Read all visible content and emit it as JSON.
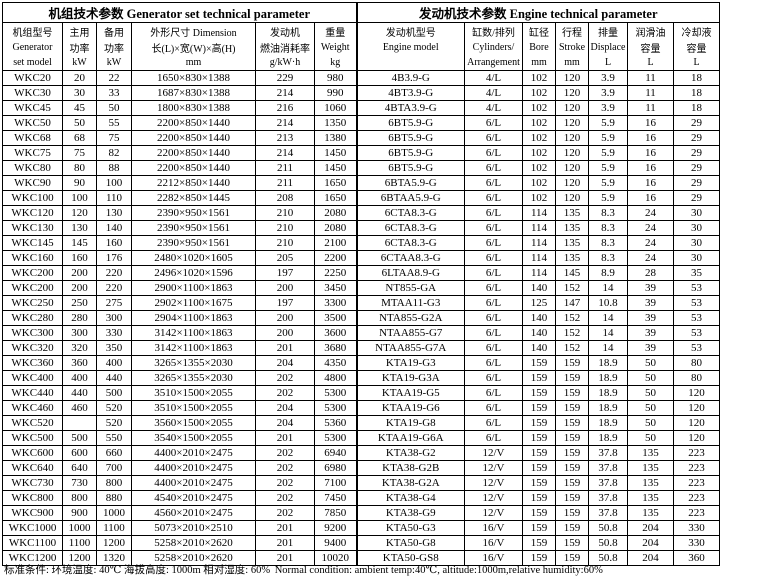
{
  "titles": {
    "generator": "机组技术参数 Generator set technical parameter",
    "engine": "发动机技术参数 Engine technical parameter"
  },
  "headers": {
    "model": [
      "机组型号",
      "Generator",
      "set model"
    ],
    "main_power": [
      "主用",
      "功率",
      "kW"
    ],
    "standby_power": [
      "备用",
      "功率",
      "kW"
    ],
    "dimension": [
      "外形尺寸 Dimension",
      "长(L)×宽(W)×高(H)",
      "mm"
    ],
    "fuel": [
      "发动机",
      "燃油消耗率",
      "g/kW·h"
    ],
    "weight": [
      "重量",
      "Weight",
      "kg"
    ],
    "engine_model": [
      "发动机型号",
      "Engine model",
      ""
    ],
    "cylinders": [
      "缸数/排列",
      "Cylinders/",
      "Arrangement"
    ],
    "bore": [
      "缸径",
      "Bore",
      "mm"
    ],
    "stroke": [
      "行程",
      "Stroke",
      "mm"
    ],
    "displace": [
      "排量",
      "Displace",
      "L"
    ],
    "oil": [
      "润滑油",
      "容量",
      "L"
    ],
    "coolant": [
      "冷却液",
      "容量",
      "L"
    ]
  },
  "rows": [
    [
      "WKC20",
      "20",
      "22",
      "1650×830×1388",
      "229",
      "980",
      "4B3.9-G",
      "4/L",
      "102",
      "120",
      "3.9",
      "11",
      "18"
    ],
    [
      "WKC30",
      "30",
      "33",
      "1687×830×1388",
      "214",
      "990",
      "4BT3.9-G",
      "4/L",
      "102",
      "120",
      "3.9",
      "11",
      "18"
    ],
    [
      "WKC45",
      "45",
      "50",
      "1800×830×1388",
      "216",
      "1060",
      "4BTA3.9-G",
      "4/L",
      "102",
      "120",
      "3.9",
      "11",
      "18"
    ],
    [
      "WKC50",
      "50",
      "55",
      "2200×850×1440",
      "214",
      "1350",
      "6BT5.9-G",
      "6/L",
      "102",
      "120",
      "5.9",
      "16",
      "29"
    ],
    [
      "WKC68",
      "68",
      "75",
      "2200×850×1440",
      "213",
      "1380",
      "6BT5.9-G",
      "6/L",
      "102",
      "120",
      "5.9",
      "16",
      "29"
    ],
    [
      "WKC75",
      "75",
      "82",
      "2200×850×1440",
      "214",
      "1450",
      "6BT5.9-G",
      "6/L",
      "102",
      "120",
      "5.9",
      "16",
      "29"
    ],
    [
      "WKC80",
      "80",
      "88",
      "2200×850×1440",
      "211",
      "1450",
      "6BT5.9-G",
      "6/L",
      "102",
      "120",
      "5.9",
      "16",
      "29"
    ],
    [
      "WKC90",
      "90",
      "100",
      "2212×850×1440",
      "211",
      "1650",
      "6BTA5.9-G",
      "6/L",
      "102",
      "120",
      "5.9",
      "16",
      "29"
    ],
    [
      "WKC100",
      "100",
      "110",
      "2282×850×1445",
      "208",
      "1650",
      "6BTAA5.9-G",
      "6/L",
      "102",
      "120",
      "5.9",
      "16",
      "29"
    ],
    [
      "WKC120",
      "120",
      "130",
      "2390×950×1561",
      "210",
      "2080",
      "6CTA8.3-G",
      "6/L",
      "114",
      "135",
      "8.3",
      "24",
      "30"
    ],
    [
      "WKC130",
      "130",
      "140",
      "2390×950×1561",
      "210",
      "2080",
      "6CTA8.3-G",
      "6/L",
      "114",
      "135",
      "8.3",
      "24",
      "30"
    ],
    [
      "WKC145",
      "145",
      "160",
      "2390×950×1561",
      "210",
      "2100",
      "6CTA8.3-G",
      "6/L",
      "114",
      "135",
      "8.3",
      "24",
      "30"
    ],
    [
      "WKC160",
      "160",
      "176",
      "2480×1020×1605",
      "205",
      "2200",
      "6CTAA8.3-G",
      "6/L",
      "114",
      "135",
      "8.3",
      "24",
      "30"
    ],
    [
      "WKC200",
      "200",
      "220",
      "2496×1020×1596",
      "197",
      "2250",
      "6LTAA8.9-G",
      "6/L",
      "114",
      "145",
      "8.9",
      "28",
      "35"
    ],
    [
      "WKC200",
      "200",
      "220",
      "2900×1100×1863",
      "200",
      "3450",
      "NT855-GA",
      "6/L",
      "140",
      "152",
      "14",
      "39",
      "53"
    ],
    [
      "WKC250",
      "250",
      "275",
      "2902×1100×1675",
      "197",
      "3300",
      "MTAA11-G3",
      "6/L",
      "125",
      "147",
      "10.8",
      "39",
      "53"
    ],
    [
      "WKC280",
      "280",
      "300",
      "2904×1100×1863",
      "200",
      "3500",
      "NTA855-G2A",
      "6/L",
      "140",
      "152",
      "14",
      "39",
      "53"
    ],
    [
      "WKC300",
      "300",
      "330",
      "3142×1100×1863",
      "200",
      "3600",
      "NTAA855-G7",
      "6/L",
      "140",
      "152",
      "14",
      "39",
      "53"
    ],
    [
      "WKC320",
      "320",
      "350",
      "3142×1100×1863",
      "201",
      "3680",
      "NTAA855-G7A",
      "6/L",
      "140",
      "152",
      "14",
      "39",
      "53"
    ],
    [
      "WKC360",
      "360",
      "400",
      "3265×1355×2030",
      "204",
      "4350",
      "KTA19-G3",
      "6/L",
      "159",
      "159",
      "18.9",
      "50",
      "80"
    ],
    [
      "WKC400",
      "400",
      "440",
      "3265×1355×2030",
      "202",
      "4800",
      "KTA19-G3A",
      "6/L",
      "159",
      "159",
      "18.9",
      "50",
      "80"
    ],
    [
      "WKC440",
      "440",
      "500",
      "3510×1500×2055",
      "202",
      "5300",
      "KTAA19-G5",
      "6/L",
      "159",
      "159",
      "18.9",
      "50",
      "120"
    ],
    [
      "WKC460",
      "460",
      "520",
      "3510×1500×2055",
      "204",
      "5300",
      "KTAA19-G6",
      "6/L",
      "159",
      "159",
      "18.9",
      "50",
      "120"
    ],
    [
      "WKC520",
      "",
      "520",
      "3560×1500×2055",
      "204",
      "5360",
      "KTA19-G8",
      "6/L",
      "159",
      "159",
      "18.9",
      "50",
      "120"
    ],
    [
      "WKC500",
      "500",
      "550",
      "3540×1500×2055",
      "201",
      "5300",
      "KTAA19-G6A",
      "6/L",
      "159",
      "159",
      "18.9",
      "50",
      "120"
    ],
    [
      "WKC600",
      "600",
      "660",
      "4400×2010×2475",
      "202",
      "6940",
      "KTA38-G2",
      "12/V",
      "159",
      "159",
      "37.8",
      "135",
      "223"
    ],
    [
      "WKC640",
      "640",
      "700",
      "4400×2010×2475",
      "202",
      "6980",
      "KTA38-G2B",
      "12/V",
      "159",
      "159",
      "37.8",
      "135",
      "223"
    ],
    [
      "WKC730",
      "730",
      "800",
      "4400×2010×2475",
      "202",
      "7100",
      "KTA38-G2A",
      "12/V",
      "159",
      "159",
      "37.8",
      "135",
      "223"
    ],
    [
      "WKC800",
      "800",
      "880",
      "4540×2010×2475",
      "202",
      "7450",
      "KTA38-G4",
      "12/V",
      "159",
      "159",
      "37.8",
      "135",
      "223"
    ],
    [
      "WKC900",
      "900",
      "1000",
      "4560×2010×2475",
      "202",
      "7850",
      "KTA38-G9",
      "12/V",
      "159",
      "159",
      "37.8",
      "135",
      "223"
    ],
    [
      "WKC1000",
      "1000",
      "1100",
      "5073×2010×2510",
      "201",
      "9200",
      "KTA50-G3",
      "16/V",
      "159",
      "159",
      "50.8",
      "204",
      "330"
    ],
    [
      "WKC1100",
      "1100",
      "1200",
      "5258×2010×2620",
      "201",
      "9400",
      "KTA50-G8",
      "16/V",
      "159",
      "159",
      "50.8",
      "204",
      "330"
    ],
    [
      "WKC1200",
      "1200",
      "1320",
      "5258×2010×2620",
      "201",
      "10020",
      "KTA50-GS8",
      "16/V",
      "159",
      "159",
      "50.8",
      "204",
      "360"
    ]
  ],
  "footer": {
    "cn": "标准条件:  环境温度: 40℃  海拔高度: 1000m  相对湿度: 60%",
    "en": "Normal condition: ambient temp:40℃, altitude:1000m,relative humidity:60%"
  }
}
